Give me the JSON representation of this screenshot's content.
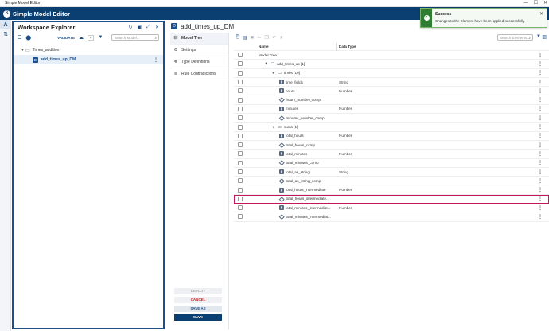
{
  "window": {
    "title": "Simple Model Editor",
    "controls": [
      "—",
      "☐",
      "✕"
    ]
  },
  "app": {
    "title": "Simple Model Editor"
  },
  "rail": {
    "items": [
      {
        "icon": "A"
      },
      {
        "icon": "⇅"
      }
    ]
  },
  "explorer": {
    "title": "Workspace Explorer",
    "validate_label": "VALIDATE",
    "search_placeholder": "Search Model...",
    "tree": [
      {
        "label": "Times_addition",
        "type": "folder"
      },
      {
        "label": "add_times_up_DM",
        "type": "dm",
        "icon_text": "D"
      }
    ]
  },
  "main": {
    "title": "add_times_up_DM",
    "icon_text": "D",
    "nav": [
      {
        "label": "Model Tree",
        "icon": "☷"
      },
      {
        "label": "Settings",
        "icon": "⚙"
      },
      {
        "label": "Type Definitions",
        "icon": "❖"
      },
      {
        "label": "Rule Contradictions",
        "icon": "≣"
      }
    ],
    "actions": {
      "deploy": "DEPLOY",
      "cancel": "CANCEL",
      "save_as": "SAVE AS",
      "save": "SAVE"
    },
    "search_placeholder": "Search Elements...",
    "columns": {
      "name": "Name",
      "type": "Data Type"
    },
    "rows": [
      {
        "name": "Model Tree",
        "type": "",
        "level": 0,
        "icon": "none",
        "expand": ""
      },
      {
        "name": "add_times_up [1]",
        "type": "",
        "level": 1,
        "icon": "fold",
        "expand": "▾"
      },
      {
        "name": "times [10]",
        "type": "",
        "level": 2,
        "icon": "fold",
        "expand": "▾"
      },
      {
        "name": "time_fields",
        "type": "String",
        "level": 3,
        "icon": "str",
        "expand": ""
      },
      {
        "name": "hours",
        "type": "Number",
        "level": 3,
        "icon": "num",
        "expand": ""
      },
      {
        "name": "hours_number_comp",
        "type": "",
        "level": 3,
        "icon": "comp",
        "expand": ""
      },
      {
        "name": "minutes",
        "type": "Number",
        "level": 3,
        "icon": "num",
        "expand": ""
      },
      {
        "name": "minutes_number_comp",
        "type": "",
        "level": 3,
        "icon": "comp",
        "expand": ""
      },
      {
        "name": "sums [1]",
        "type": "",
        "level": 2,
        "icon": "fold",
        "expand": "▾"
      },
      {
        "name": "total_hours",
        "type": "Number",
        "level": 3,
        "icon": "num",
        "expand": ""
      },
      {
        "name": "total_hours_comp",
        "type": "",
        "level": 3,
        "icon": "comp",
        "expand": ""
      },
      {
        "name": "total_minutes",
        "type": "Number",
        "level": 3,
        "icon": "num",
        "expand": ""
      },
      {
        "name": "total_minutes_comp",
        "type": "",
        "level": 3,
        "icon": "comp",
        "expand": ""
      },
      {
        "name": "total_as_string",
        "type": "String",
        "level": 3,
        "icon": "str",
        "expand": ""
      },
      {
        "name": "total_as_string_comp",
        "type": "",
        "level": 3,
        "icon": "comp",
        "expand": ""
      },
      {
        "name": "total_hours_intermediate",
        "type": "Number",
        "level": 3,
        "icon": "num",
        "expand": ""
      },
      {
        "name": "total_hours_intermediate...",
        "type": "",
        "level": 3,
        "icon": "comp",
        "expand": "",
        "highlight": true
      },
      {
        "name": "total_minutes_intermediat...",
        "type": "Number",
        "level": 3,
        "icon": "num",
        "expand": ""
      },
      {
        "name": "total_minutes_intermediat...",
        "type": "",
        "level": 3,
        "icon": "comp",
        "expand": ""
      }
    ]
  },
  "toast": {
    "title": "Success",
    "message": "Changes to the Element have been applied successfully.",
    "check": "✓",
    "close": "✕"
  },
  "colors": {
    "brand": "#0b3f72",
    "accent": "#1d4f8a",
    "highlight": "#c2185b",
    "success": "#2e7d32"
  }
}
